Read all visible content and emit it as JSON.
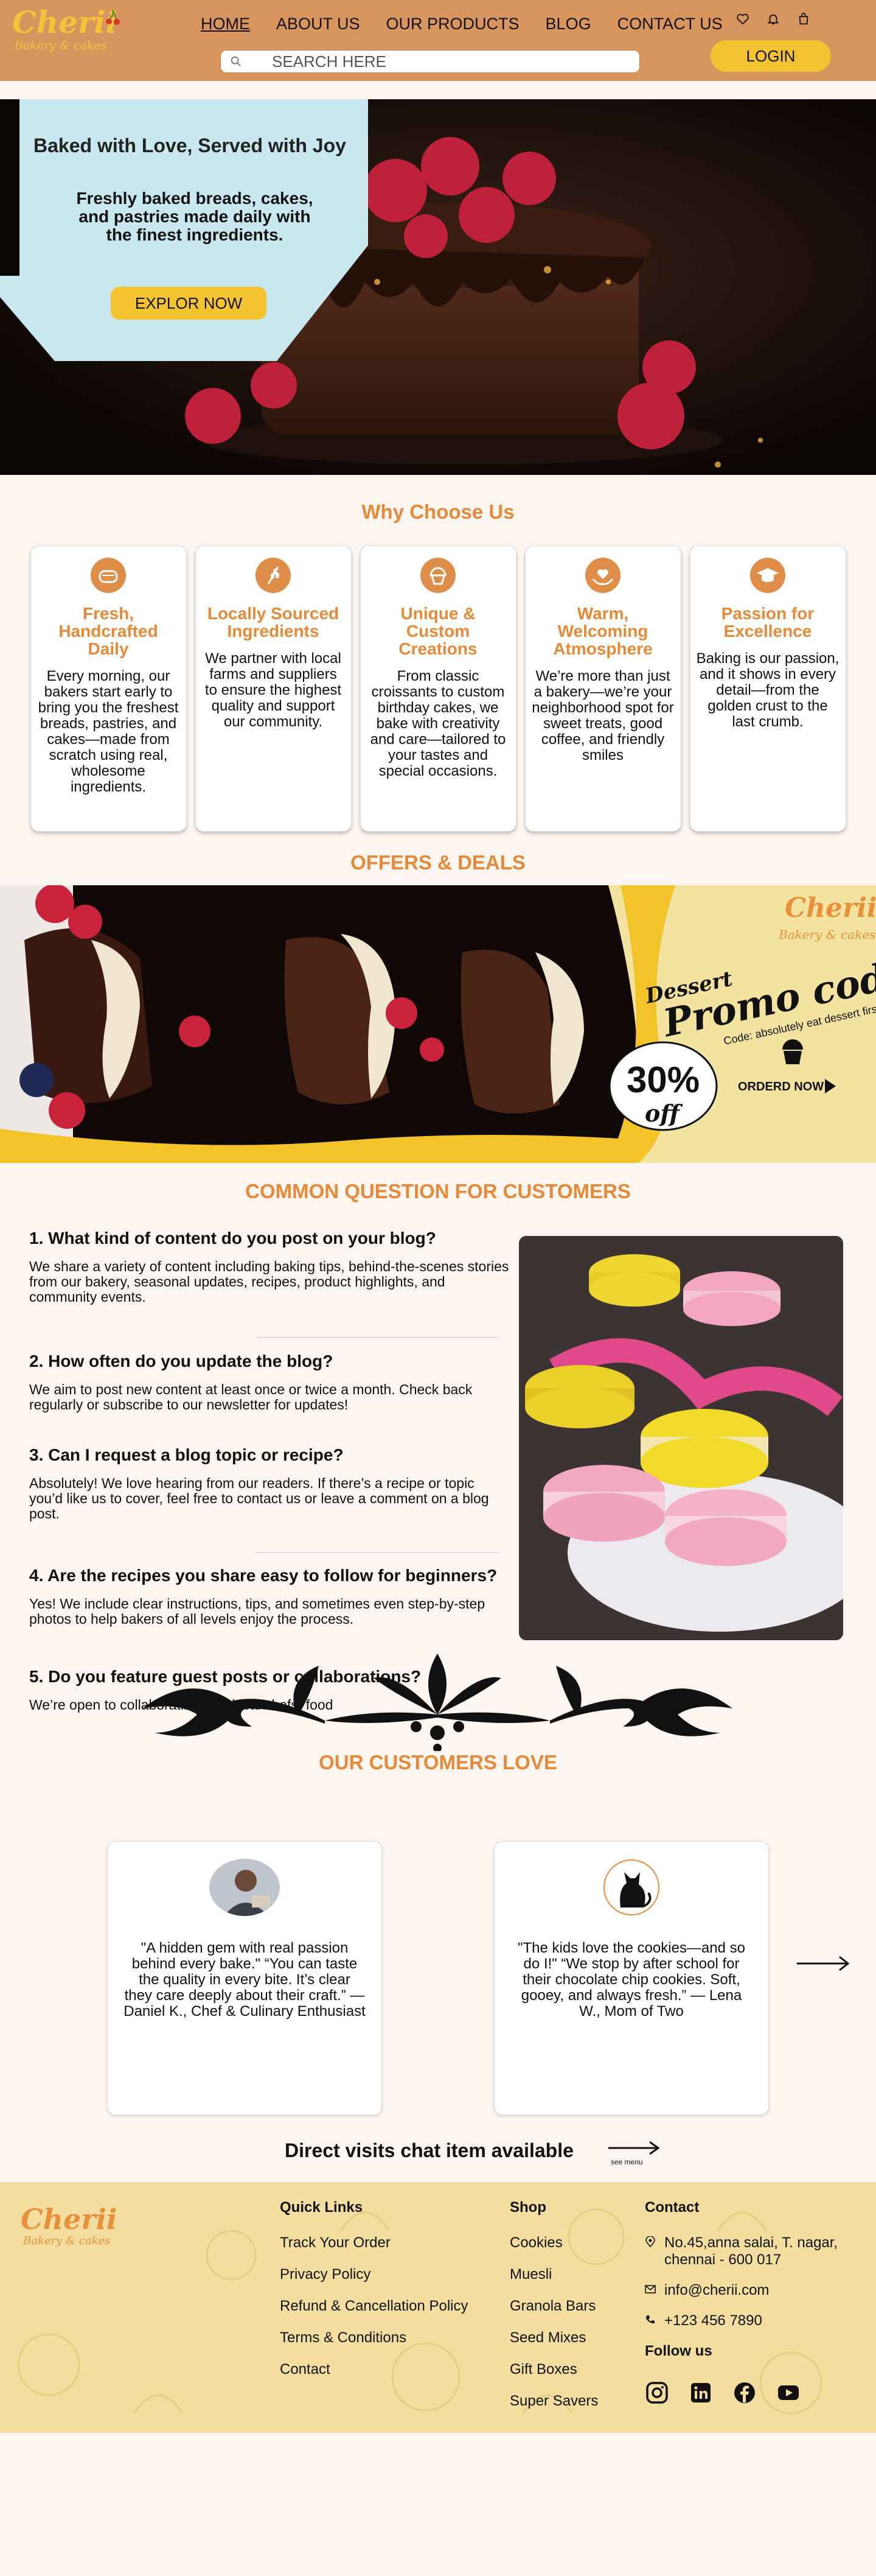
{
  "brand": {
    "name": "Cherii",
    "tagline": "Bakery & cakes"
  },
  "nav": [
    "HOME",
    "ABOUT US",
    "OUR PRODUCTS",
    "BLOG",
    "CONTACT US"
  ],
  "search": {
    "placeholder": "SEARCH HERE"
  },
  "login_label": "LOGIN",
  "header_icons": [
    "heart-icon",
    "bell-icon",
    "cart-icon"
  ],
  "hero": {
    "title": "Baked with Love, Served with Joy",
    "text": "Freshly baked breads, cakes, and pastries made daily with the finest ingredients.",
    "button": "EXPLOR NOW"
  },
  "why": {
    "title": "Why Choose Us",
    "cards": [
      {
        "icon": "bread-icon",
        "title": "Fresh, Handcrafted Daily",
        "text": "Every morning, our bakers start early to bring you the freshest breads, pastries, and cakes—made from scratch using real, wholesome ingredients."
      },
      {
        "icon": "wheat-icon",
        "title": "Locally Sourced Ingredients",
        "text": "We partner with local farms and suppliers to ensure the highest quality and support our community."
      },
      {
        "icon": "cupcake-icon",
        "title": "Unique & Custom Creations",
        "text": "From classic croissants to custom birthday cakes, we bake with creativity and care—tailored to your tastes and special occasions."
      },
      {
        "icon": "heart-hands-icon",
        "title": "Warm, Welcoming Atmosphere",
        "text": "We’re more than just a bakery—we’re your neighborhood spot for sweet treats, good coffee, and friendly smiles"
      },
      {
        "icon": "graduation-cap-icon",
        "title": "Passion for Excellence",
        "text": "Baking is our passion, and it shows in every detail—from the golden crust to the last crumb."
      }
    ]
  },
  "offers": {
    "title": "OFFERS & DEALS",
    "banner": {
      "brand": "Cherii",
      "tagline": "Bakery & cakes",
      "dessert": "Dessert",
      "promo": "Promo code",
      "note": "Code: absolutely eat dessert first",
      "discount": "30%",
      "off": "off",
      "cta": "ORDERD NOW"
    }
  },
  "faq": {
    "title": "COMMON QUESTION FOR CUSTOMERS",
    "items": [
      {
        "q": "1. What kind of content do you post on your blog?",
        "a": "We share a variety of content including baking tips, behind-the-scenes stories from our bakery, seasonal updates, recipes, product highlights, and community events."
      },
      {
        "q": "2. How often do you update the blog?",
        "a": "We aim to post new content at least once or twice a month. Check back regularly or subscribe to our newsletter for updates!"
      },
      {
        "q": "3. Can I request a blog topic or recipe?",
        "a": "Absolutely! We love hearing from our readers. If there’s a recipe or topic you’d like us to cover, feel free to contact us or leave a comment on a blog post."
      },
      {
        "q": "4. Are the recipes you share easy to follow for beginners?",
        "a": "Yes! We include clear instructions, tips, and sometimes even step-by-step photos to help bakers of all levels enjoy the process."
      },
      {
        "q": "5. Do you feature guest posts or collaborations?",
        "a": "We’re open to collaborating with local chefs, food"
      }
    ]
  },
  "testimonials": {
    "title": "OUR CUSTOMERS LOVE",
    "items": [
      {
        "text": "\"A hidden gem with real passion behind every bake.\" “You can taste the quality in every bite. It’s clear they care deeply about their craft.” — Daniel K., Chef & Culinary Enthusiast"
      },
      {
        "text": "\"The kids love the cookies—and so do I!\" “We stop by after school for their chocolate chip cookies. Soft, gooey, and always fresh.” — Lena W., Mom of Two"
      }
    ]
  },
  "chat": {
    "text": "Direct visits chat item available",
    "see_menu": "see menu"
  },
  "footer": {
    "quick_links": {
      "title": "Quick Links",
      "items": [
        "Track Your Order",
        "Privacy Policy",
        "Refund & Cancellation Policy",
        "Terms & Conditions",
        "Contact"
      ]
    },
    "shop": {
      "title": "Shop",
      "items": [
        "Cookies",
        "Muesli",
        "Granola Bars",
        "Seed Mixes",
        "Gift Boxes",
        "Super Savers"
      ]
    },
    "contact": {
      "title": "Contact",
      "address": "No.45,anna salai, T. nagar, chennai - 600 017",
      "email": "info@cherii.com",
      "phone": "+123 456 7890",
      "follow": "Follow us",
      "socials": [
        "instagram-icon",
        "linkedin-icon",
        "facebook-icon",
        "youtube-icon"
      ]
    }
  },
  "colors": {
    "header": "#d9955e",
    "accent": "#e68a3a",
    "yellow": "#f2c230",
    "footer": "#f3dea0",
    "page": "#fdf6f0"
  }
}
